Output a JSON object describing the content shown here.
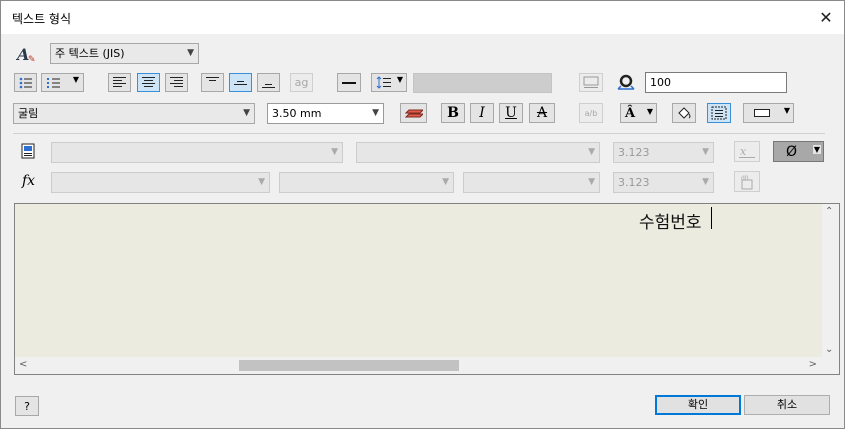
{
  "window": {
    "title": "텍스트 형식",
    "close_label": "✕"
  },
  "row1": {
    "style_value": "주 텍스트 (JIS)"
  },
  "row2": {
    "bullet_glyph": "⋮≡",
    "number_glyph": "⋮≡",
    "ag_label": "ag",
    "stretch_value": "100",
    "line_spacing_value": ""
  },
  "row3": {
    "font_value": "굴림",
    "size_value": "3.50 mm",
    "bold_label": "B",
    "italic_label": "I",
    "underline_label": "U",
    "strike_label": "A",
    "stack_label": "a/b",
    "symbol_label": "Â"
  },
  "param_row": {
    "combo1": "",
    "combo2": "",
    "precision": "3.123",
    "symbol_button": "Ø"
  },
  "fx_row": {
    "fx_label": "fx",
    "combo1": "",
    "combo2": "",
    "combo3": "",
    "precision": "3.123"
  },
  "editor": {
    "text": "수험번호"
  },
  "footer": {
    "help_label": "?",
    "ok_label": "확인",
    "cancel_label": "취소"
  }
}
